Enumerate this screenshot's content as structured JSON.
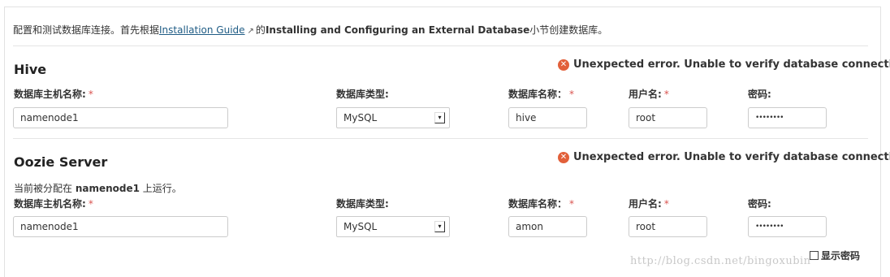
{
  "intro": {
    "prefix": "配置和测试数据库连接。首先根据",
    "link_label": "Installation Guide",
    "link_icon": "external-link-icon",
    "middle": "的",
    "bold_section": "Installing and Configuring an External Database",
    "suffix": "小节创建数据库。"
  },
  "labels": {
    "host": "数据库主机名称:",
    "type": "数据库类型:",
    "db_name": "数据库名称：",
    "user": "用户名:",
    "password": "密码:",
    "required_mark": "*"
  },
  "error_message": "Unexpected error. Unable to verify database connection.",
  "error_icon": "error-circle-icon",
  "hive": {
    "title": "Hive",
    "host": "namenode1",
    "db_type": "MySQL",
    "db_name": "hive",
    "user": "root",
    "password": "••••••••"
  },
  "oozie": {
    "title": "Oozie Server",
    "note_prefix": "当前被分配在 ",
    "note_host": "namenode1",
    "note_suffix": " 上运行。",
    "host": "namenode1",
    "db_type": "MySQL",
    "db_name": "amon",
    "user": "root",
    "password": "••••••••"
  },
  "show_password_label": "显示密码",
  "watermark": "http://blog.csdn.net/bingoxubin",
  "colors": {
    "error": "#e2603a",
    "link": "#1f5c85",
    "required": "#d9534f"
  }
}
